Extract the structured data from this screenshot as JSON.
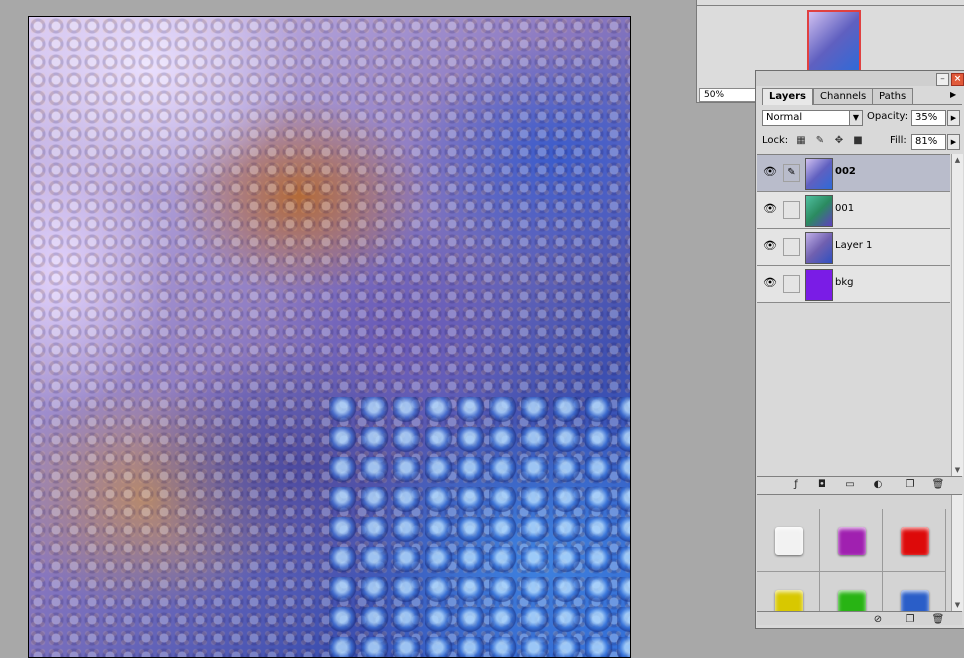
{
  "canvas": {
    "image": "fractal-bubbles-artwork"
  },
  "navigator": {
    "zoom": "50%",
    "thumbnail_border_color": "#e04040"
  },
  "layers_panel": {
    "tabs": [
      {
        "label": "Layers",
        "active": true
      },
      {
        "label": "Channels",
        "active": false
      },
      {
        "label": "Paths",
        "active": false
      }
    ],
    "blend_mode": "Normal",
    "opacity_label": "Opacity:",
    "opacity": "35%",
    "lock_label": "Lock:",
    "fill_label": "Fill:",
    "fill": "81%",
    "layers": [
      {
        "name": "002",
        "selected": true,
        "visible": true,
        "thumb": "fractal"
      },
      {
        "name": "001",
        "selected": false,
        "visible": true,
        "thumb": "green-fractal"
      },
      {
        "name": "Layer 1",
        "selected": false,
        "visible": true,
        "thumb": "fractal"
      },
      {
        "name": "bkg",
        "selected": false,
        "visible": true,
        "thumb": "solid-purple",
        "color": "#7a1ce6"
      }
    ],
    "action_icons": [
      "link-icon",
      "fx-icon",
      "mask-icon",
      "folder-icon",
      "adjustment-icon",
      "new-layer-icon",
      "trash-icon"
    ]
  },
  "styles_panel": {
    "swatches": [
      {
        "name": "white",
        "color": "#f2f2f2"
      },
      {
        "name": "purple",
        "color": "#a020b0"
      },
      {
        "name": "red",
        "color": "#dd0a0a"
      },
      {
        "name": "yellow",
        "color": "#d8c800"
      },
      {
        "name": "green",
        "color": "#28b414"
      },
      {
        "name": "blue",
        "color": "#2a5ec8"
      }
    ]
  },
  "colors": {
    "selection_highlight": "#b9bccb",
    "panel_bg": "#d9d9d9",
    "workspace_bg": "#a8a8a8"
  }
}
